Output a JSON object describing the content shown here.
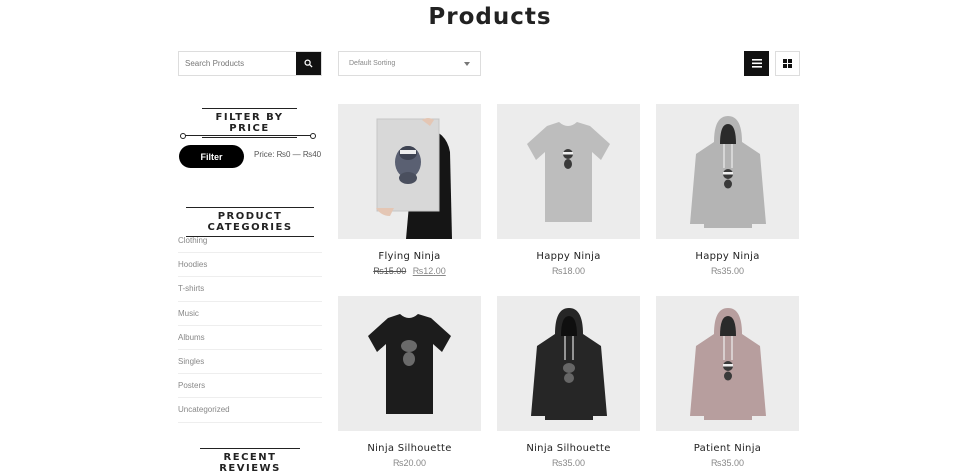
{
  "page": {
    "title": "Products"
  },
  "search": {
    "placeholder": "Search Products"
  },
  "sorting": {
    "selected": "Default Sorting"
  },
  "view_toggle": {
    "active": "list"
  },
  "filter": {
    "title": "FILTER BY PRICE",
    "button_label": "Filter",
    "range_label": "Price: ₨0 — ₨40",
    "min": 0,
    "max": 40
  },
  "categories": {
    "title": "PRODUCT CATEGORIES",
    "items": [
      {
        "label": "Clothing"
      },
      {
        "label": "Hoodies"
      },
      {
        "label": "T-shirts"
      },
      {
        "label": "Music"
      },
      {
        "label": "Albums"
      },
      {
        "label": "Singles"
      },
      {
        "label": "Posters"
      },
      {
        "label": "Uncategorized"
      }
    ]
  },
  "reviews": {
    "title": "RECENT REVIEWS"
  },
  "products": [
    {
      "name": "Flying Ninja",
      "price": "₨12.00",
      "old_price": "₨15.00",
      "kind": "poster",
      "color": "#d6d6d6"
    },
    {
      "name": "Happy Ninja",
      "price": "₨18.00",
      "kind": "tshirt",
      "color": "#bdbdbd"
    },
    {
      "name": "Happy Ninja",
      "price": "₨35.00",
      "kind": "hoodie",
      "color": "#b4b4b4"
    },
    {
      "name": "Ninja Silhouette",
      "price": "₨20.00",
      "kind": "tshirt",
      "color": "#1c1c1c"
    },
    {
      "name": "Ninja Silhouette",
      "price": "₨35.00",
      "kind": "hoodie",
      "color": "#262626"
    },
    {
      "name": "Patient Ninja",
      "price": "₨35.00",
      "kind": "hoodie",
      "color": "#b79e9e"
    }
  ]
}
